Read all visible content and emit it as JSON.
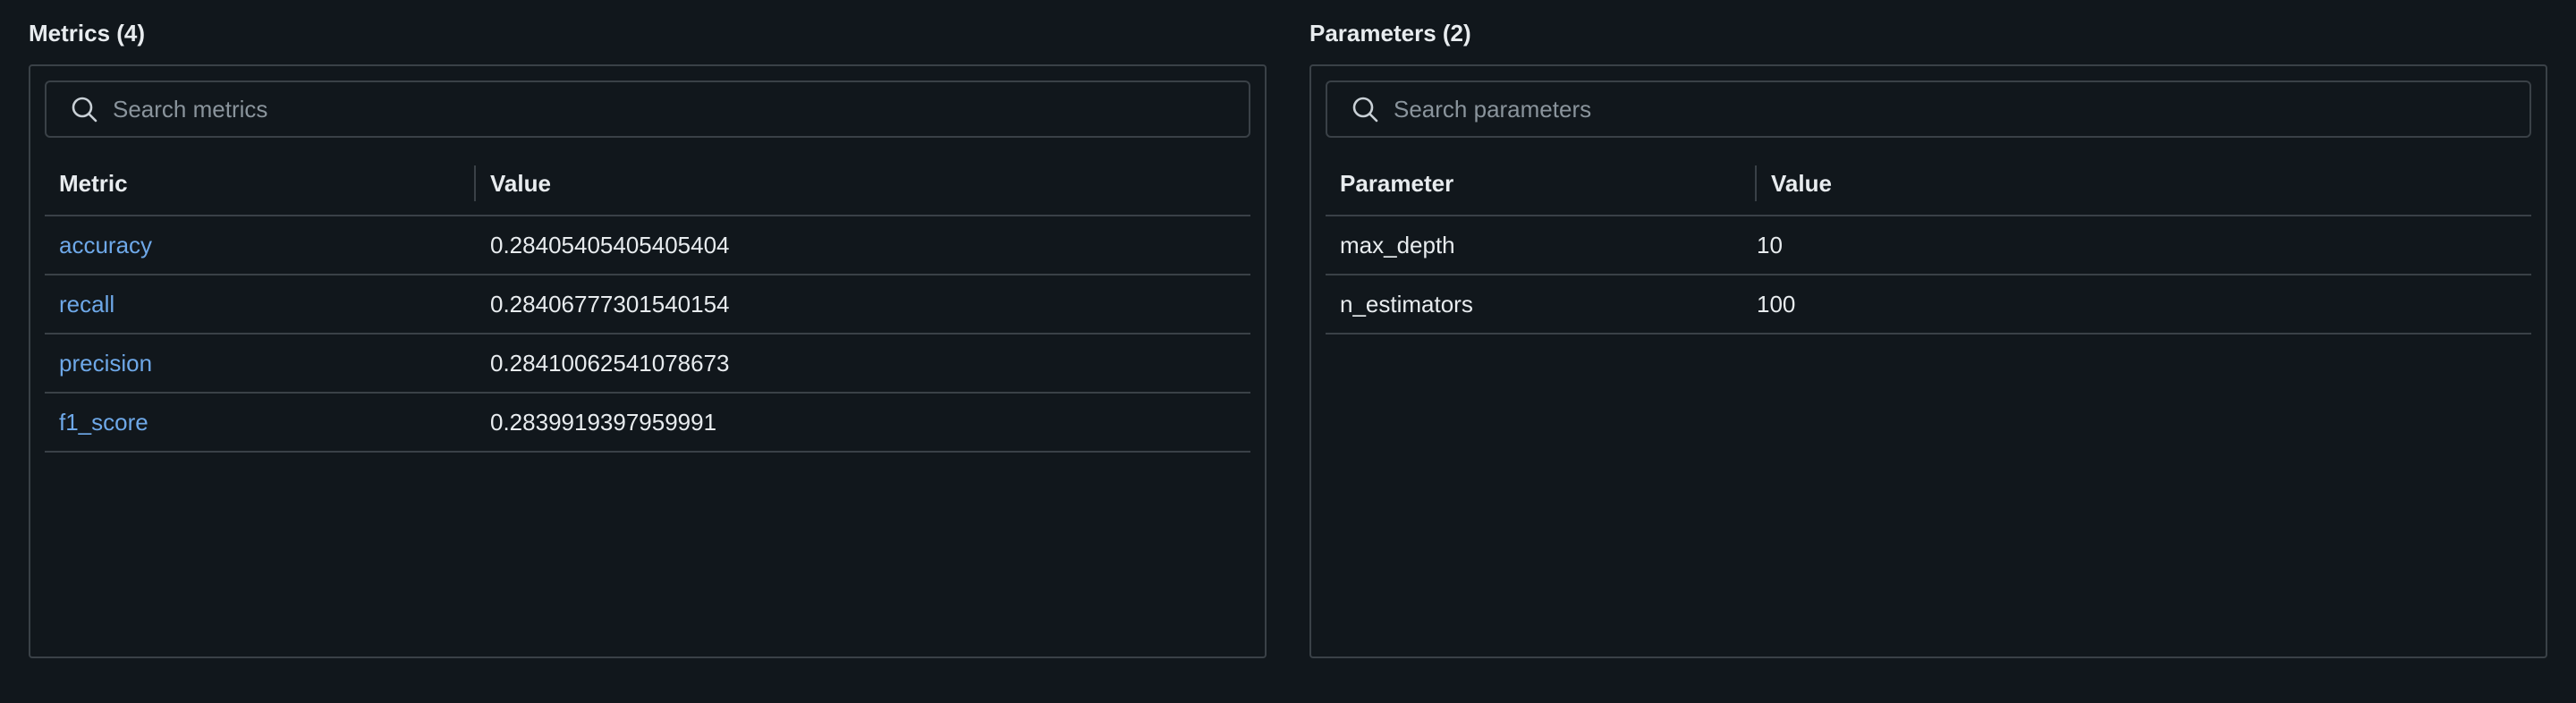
{
  "metrics": {
    "title": "Metrics (4)",
    "search_placeholder": "Search metrics",
    "columns": [
      "Metric",
      "Value"
    ],
    "rows": [
      {
        "name": "accuracy",
        "value": "0.28405405405405404"
      },
      {
        "name": "recall",
        "value": "0.28406777301540154"
      },
      {
        "name": "precision",
        "value": "0.28410062541078673"
      },
      {
        "name": "f1_score",
        "value": "0.2839919397959991"
      }
    ]
  },
  "parameters": {
    "title": "Parameters (2)",
    "search_placeholder": "Search parameters",
    "columns": [
      "Parameter",
      "Value"
    ],
    "rows": [
      {
        "name": "max_depth",
        "value": "10"
      },
      {
        "name": "n_estimators",
        "value": "100"
      }
    ]
  },
  "colors": {
    "background": "#11171c",
    "border": "#3a4147",
    "link": "#6ea8e8",
    "text": "#e8ecef",
    "placeholder": "#8a949c"
  },
  "icons": [
    "search-icon"
  ]
}
